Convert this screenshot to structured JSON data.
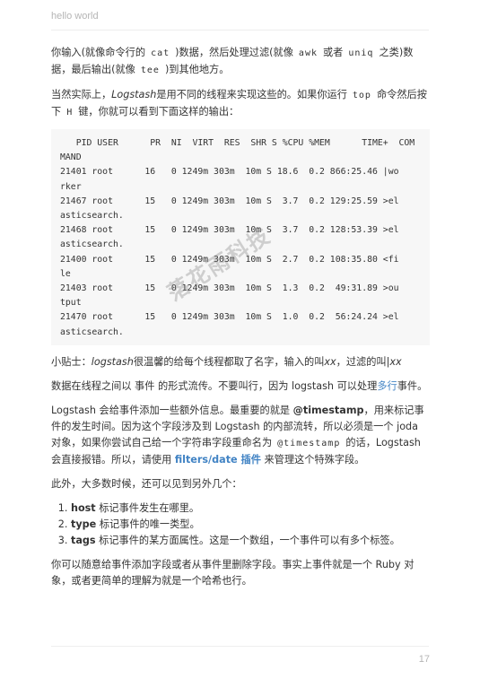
{
  "header": {
    "title": "hello world"
  },
  "paragraphs": {
    "p1": {
      "a": "你输入(就像命令行的",
      "code1": "cat",
      "b": ")数据，然后处理过滤(就像",
      "code2": "awk",
      "c": "或者",
      "code3": "uniq",
      "d": "之类)数据，最后输出(就像",
      "code4": "tee",
      "e": ")到其他地方。"
    },
    "p2": {
      "a": "当然实际上，",
      "em1": "Logstash",
      "b": "是用不同的线程来实现这些的。如果你运行",
      "code1": "top",
      "c": "命令然后按下",
      "code2": "H",
      "d": "键，你就可以看到下面这样的输出："
    },
    "code_block": "   PID USER      PR  NI  VIRT  RES  SHR S %CPU %MEM      TIME+  COM\nMAND\n21401 root      16   0 1249m 303m  10m S 18.6  0.2 866:25.46 |wo\nrker\n21467 root      15   0 1249m 303m  10m S  3.7  0.2 129:25.59 >el\nasticsearch.\n21468 root      15   0 1249m 303m  10m S  3.7  0.2 128:53.39 >el\nasticsearch.\n21400 root      15   0 1249m 303m  10m S  2.7  0.2 108:35.80 <fi\nle\n21403 root      15   0 1249m 303m  10m S  1.3  0.2  49:31.89 >ou\ntput\n21470 root      15   0 1249m 303m  10m S  1.0  0.2  56:24.24 >el\nasticsearch.",
    "p3": {
      "a": "小贴士：",
      "em1": "logstash",
      "b": "很温馨的给每个线程都取了名字，输入的叫",
      "em2": "xx",
      "c": "，过滤的叫",
      "em3": "|xx"
    },
    "p4": {
      "a": "数据在线程之间以 事件 的形式流传。不要叫行，因为 logstash 可以处理",
      "link1": "多行",
      "b": "事件。"
    },
    "p5": {
      "a": "Logstash 会给事件添加一些额外信息。最重要的就是 ",
      "bold1": "@timestamp",
      "b": "，用来标记事件的发生时间。因为这个字段涉及到 Logstash 的内部流转，所以必须是一个 joda 对象，如果你尝试自己给一个字符串字段重命名为",
      "code1": "@timestamp",
      "c": "的话，Logstash 会直接报错。所以，请使用 ",
      "link1": "filters/date 插件",
      "d": " 来管理这个特殊字段。"
    },
    "p6": "此外，大多数时候，还可以见到另外几个：",
    "list": [
      {
        "bold": "host",
        "text": " 标记事件发生在哪里。"
      },
      {
        "bold": "type",
        "text": " 标记事件的唯一类型。"
      },
      {
        "bold": "tags",
        "text": " 标记事件的某方面属性。这是一个数组，一个事件可以有多个标签。"
      }
    ],
    "p7": "你可以随意给事件添加字段或者从事件里删除字段。事实上事件就是一个 Ruby 对象，或者更简单的理解为就是一个哈希也行。"
  },
  "watermark": "落花雨科技",
  "footer": {
    "page_number": "17"
  }
}
